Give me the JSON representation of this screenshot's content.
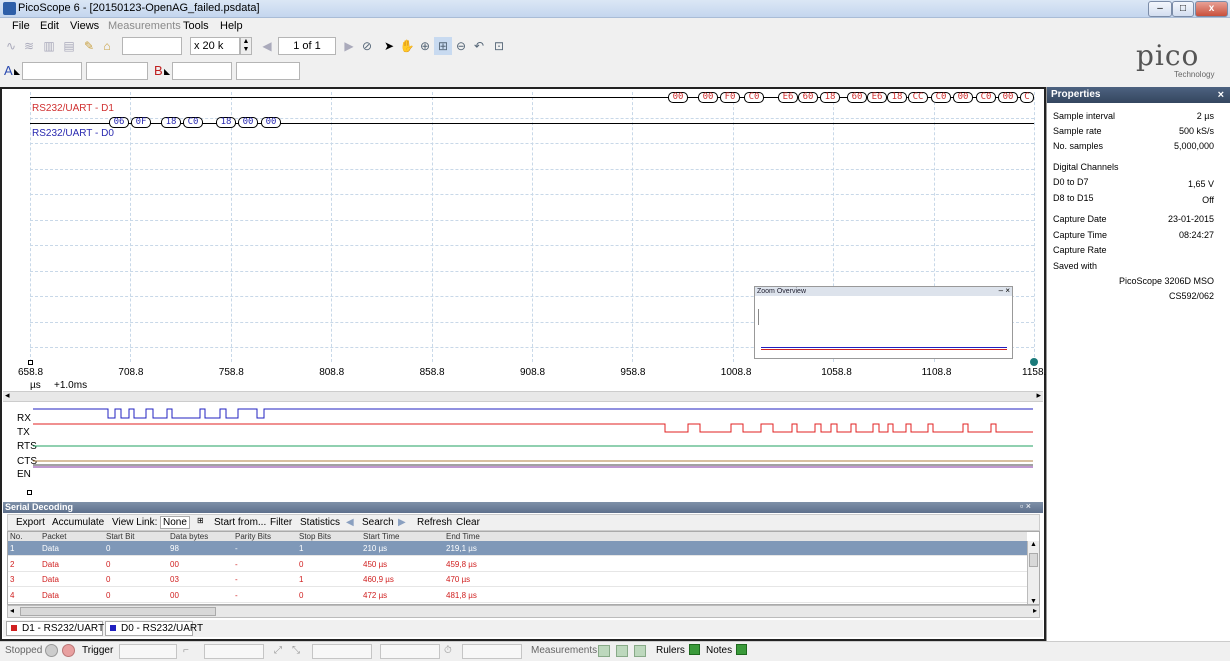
{
  "window": {
    "title": "PicoScope 6 - [20150123-OpenAG_failed.psdata]",
    "controls": [
      "–",
      "□",
      "x"
    ]
  },
  "menu": [
    {
      "label": "File",
      "enabled": true
    },
    {
      "label": "Edit",
      "enabled": true
    },
    {
      "label": "Views",
      "enabled": true
    },
    {
      "label": "Measurements",
      "enabled": false
    },
    {
      "label": "Tools",
      "enabled": true
    },
    {
      "label": "Help",
      "enabled": true
    }
  ],
  "toolbar": {
    "zoom": "x 20 k",
    "buffer": "1 of 1",
    "channel_a_label": "A",
    "channel_b_label": "B"
  },
  "logo": {
    "word": "pico",
    "sub": "Technology"
  },
  "scope": {
    "ch_d1_label": "RS232/UART - D1",
    "ch_d0_label": "RS232/UART - D0",
    "d1_packets": [
      "00",
      "00",
      "F0",
      "C0",
      "E6",
      "60",
      "18",
      "60",
      "E6",
      "18",
      "CC",
      "C0",
      "00",
      "C0",
      "00",
      "C"
    ],
    "d0_packets": [
      "06",
      "0F",
      "18",
      "C0",
      "18",
      "00",
      "00"
    ],
    "x_ticks": [
      "658.8",
      "708.8",
      "758.8",
      "808.8",
      "858.8",
      "908.8",
      "958.8",
      "1008.8",
      "1058.8",
      "1108.8",
      "1158.8"
    ],
    "x_unit": "µs",
    "x_offset": "+1.0ms",
    "zoom_overview_title": "Zoom Overview"
  },
  "digital": {
    "channels": [
      "RX",
      "TX",
      "RTS",
      "CTS",
      "EN"
    ],
    "colors": {
      "RX": "#2020c0",
      "TX": "#e02020",
      "RTS": "#20a060",
      "CTS": "#b08040",
      "EN": "#8030a0"
    }
  },
  "serial_decoding": {
    "title": "Serial Decoding",
    "toolbar": {
      "export": "Export",
      "accumulate": "Accumulate",
      "view_link": "View Link:",
      "view_link_value": "None",
      "start_from": "Start from...",
      "filter": "Filter",
      "statistics": "Statistics",
      "search": "Search",
      "refresh": "Refresh",
      "clear": "Clear"
    },
    "columns": [
      "No.",
      "Packet",
      "Start Bit",
      "Data bytes",
      "Parity Bits",
      "Stop Bits",
      "Start Time",
      "End Time"
    ],
    "rows": [
      [
        "1",
        "Data",
        "0",
        "98",
        "-",
        "1",
        "210 µs",
        "219,1 µs"
      ],
      [
        "2",
        "Data",
        "0",
        "00",
        "-",
        "0",
        "450 µs",
        "459,8 µs"
      ],
      [
        "3",
        "Data",
        "0",
        "03",
        "-",
        "1",
        "460,9 µs",
        "470 µs"
      ],
      [
        "4",
        "Data",
        "0",
        "00",
        "-",
        "0",
        "472 µs",
        "481,8 µs"
      ]
    ],
    "tabs": [
      {
        "label": "D1 - RS232/UART",
        "color": "#d02020"
      },
      {
        "label": "D0 - RS232/UART",
        "color": "#2020c0"
      }
    ]
  },
  "properties": {
    "title": "Properties",
    "close": "×",
    "sample_interval": {
      "k": "Sample interval",
      "v": "2 µs"
    },
    "sample_rate": {
      "k": "Sample rate",
      "v": "500 kS/s"
    },
    "no_samples": {
      "k": "No. samples",
      "v": "5,000,000"
    },
    "digital_channels": "Digital Channels",
    "d0_d7": {
      "k": "D0 to D7",
      "v": "1,65 V"
    },
    "d8_d15": {
      "k": "D8 to D15",
      "v": "Off"
    },
    "capture_date": {
      "k": "Capture Date",
      "v": "23-01-2015"
    },
    "capture_time": {
      "k": "Capture Time",
      "v": "08:24:27"
    },
    "capture_rate": {
      "k": "Capture Rate",
      "v": ""
    },
    "saved_with": {
      "k": "Saved with",
      "v1": "PicoScope 3206D MSO",
      "v2": "CS592/062"
    }
  },
  "statusbar": {
    "stopped": "Stopped",
    "trigger": "Trigger",
    "measurements": "Measurements",
    "rulers": "Rulers",
    "notes": "Notes"
  }
}
